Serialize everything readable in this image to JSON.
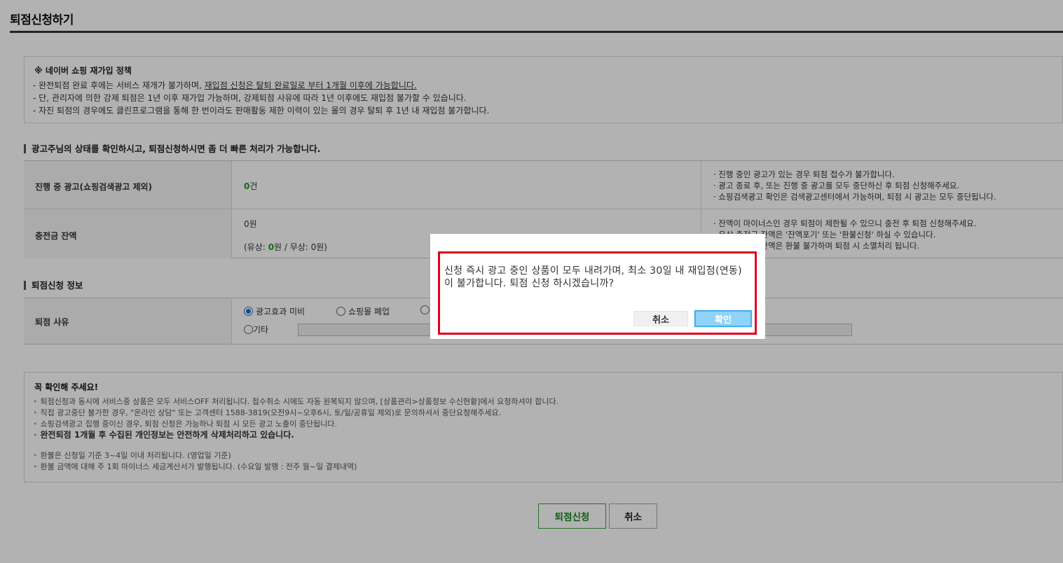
{
  "page": {
    "title": "퇴점신청하기"
  },
  "policy": {
    "title": "※ 네이버 쇼핑 재가입 정책",
    "line1_pre": "- 완전퇴점 완료 후에는 서비스 재개가 불가하며, ",
    "line1_link": "재입점 신청은 탈퇴 완료일로 부터 1개월 이후에 가능합니다.",
    "line2": "- 단, 관리자에 의한 강제 퇴점은 1년 이후 재가입 가능하며, 강제퇴점 사유에 따라 1년 이후에도 재입점 불가할 수 있습니다.",
    "line3": "- 자진 퇴점의 경우에도 클린프로그램을 통해 한 번이라도 판매활동 제한 이력이 있는 몰의 경우 탈퇴 후 1년 내 재입점 불가합니다."
  },
  "status_section": {
    "title": "광고주님의 상태를 확인하시고, 퇴점신청하시면 좀 더 빠른 처리가 가능합니다.",
    "ads_row": {
      "label": "진행 중 광고(쇼핑검색광고 제외)",
      "count": "0",
      "count_unit": "건",
      "notes": [
        "· 진행 중인 광고가 있는 경우 퇴점 접수가 불가합니다.",
        "· 광고 종료 후, 또는 진행 중 광고를 모두 중단하신 후 퇴점 신청해주세요.",
        "· 쇼핑검색광고 확인은 검색광고센터에서 가능하며, 퇴점 시 광고는 모두 중단됩니다."
      ]
    },
    "balance_row": {
      "label": "충전금 잔액",
      "total": "0원",
      "paid_pre": "(유상: ",
      "paid_value": "0",
      "paid_post": "원 / 무상: 0원)",
      "notes": [
        "· 잔액이 마이너스인 경우 퇴점이 제한될 수 있으니 충전 후 퇴점 신청해주세요.",
        "· 유상 충전금 잔액은 '잔액포기' 또는 '환불신청' 하실 수 있습니다.",
        "· 무상 충전금 잔액은 환불 불가하며 퇴점 시 소멸처리 됩니다."
      ]
    }
  },
  "apply_section": {
    "title": "퇴점신청 정보",
    "reason_label": "퇴점 사유",
    "options": [
      "광고효과 미비",
      "쇼핑몰 폐업",
      "",
      "기타"
    ],
    "selected_index": 0
  },
  "notice": {
    "title": "꼭 확인해 주세요!",
    "lines": [
      "퇴점신청과 동시에 서비스중 상품은 모두 서비스OFF 처리됩니다. 접수취소 시에도 자동 원복되지 않으며, [상품관리>상품정보 수신현황]에서 요청하셔야 합니다.",
      "직접 광고중단 불가한 경우, \"온라인 상담\" 또는 고객센터 1588-3819(오전9시~오후6시, 토/일/공휴일 제외)로 문의하셔서 중단요청해주세요.",
      "쇼핑검색광고 집행 중이신 경우, 퇴점 신청은 가능하나 퇴점 시 모든 광고 노출이 중단됩니다.",
      "완전퇴점 1개월 후 수집된 개인정보는 안전하게 삭제처리하고 있습니다.",
      "환불은 신청일 기준 3~4일 이내 처리됩니다. (영업일 기준)",
      "환불 금액에 대해 주 1회 마이너스 세금계산서가 발행됩니다. (수요일 발행 : 전주 월~일 결제내역)"
    ]
  },
  "buttons": {
    "apply": "퇴점신청",
    "cancel": "취소"
  },
  "dialog": {
    "message": "신청 즉시 광고 중인 상품이 모두 내려가며, 최소 30일 내 재입점(연동)이 불가합니다. 퇴점 신청 하시겠습니까?",
    "cancel": "취소",
    "ok": "확인"
  },
  "colors": {
    "accent_green": "#1c9b1c",
    "dialog_highlight": "#e0001a",
    "ok_button": "#8fd3f8"
  }
}
